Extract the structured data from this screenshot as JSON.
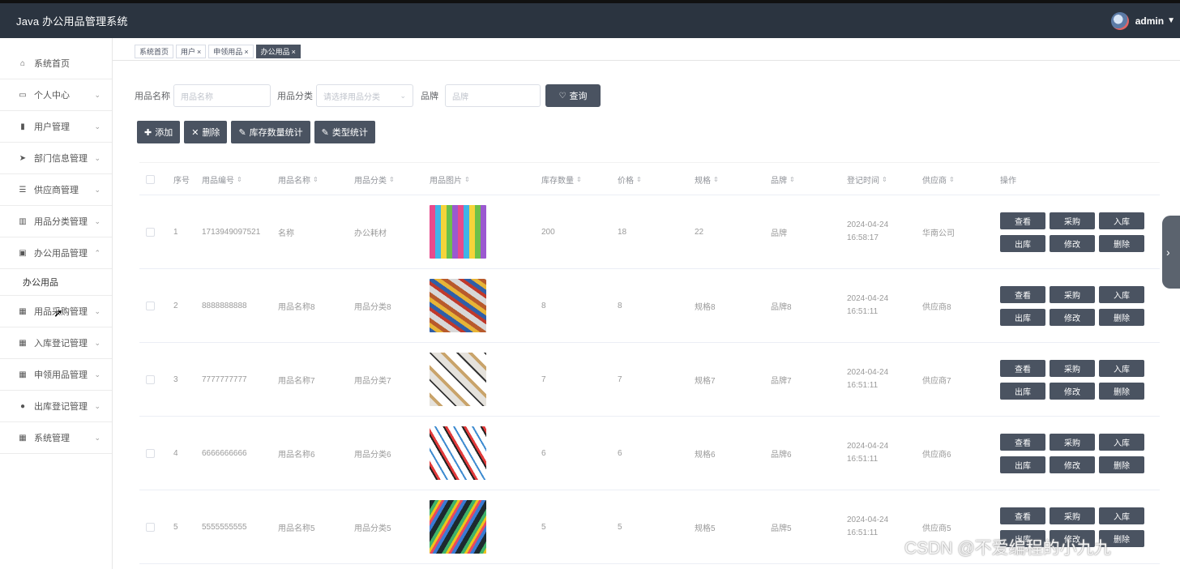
{
  "app": {
    "title": "Java 办公用品管理系统",
    "user": "admin"
  },
  "sidebar": {
    "items": [
      {
        "label": "系统首页",
        "icon": "home-icon",
        "glyph": "⌂",
        "arrow": false
      },
      {
        "label": "个人中心",
        "icon": "person-icon",
        "glyph": "▭",
        "arrow": true
      },
      {
        "label": "用户管理",
        "icon": "user-icon",
        "glyph": "▮",
        "arrow": true
      },
      {
        "label": "部门信息管理",
        "icon": "send-icon",
        "glyph": "➤",
        "arrow": true
      },
      {
        "label": "供应商管理",
        "icon": "sliders-icon",
        "glyph": "☰",
        "arrow": true
      },
      {
        "label": "用品分类管理",
        "icon": "bar-chart-icon",
        "glyph": "▥",
        "arrow": true
      },
      {
        "label": "办公用品管理",
        "icon": "clipboard-icon",
        "glyph": "▣",
        "arrow": true,
        "expanded": true
      },
      {
        "label": "用品采购管理",
        "icon": "grid-icon",
        "glyph": "▦",
        "arrow": true
      },
      {
        "label": "入库登记管理",
        "icon": "grid-icon",
        "glyph": "▦",
        "arrow": true
      },
      {
        "label": "申领用品管理",
        "icon": "grid-icon",
        "glyph": "▦",
        "arrow": true
      },
      {
        "label": "出库登记管理",
        "icon": "shield-icon",
        "glyph": "●",
        "arrow": true
      },
      {
        "label": "系统管理",
        "icon": "grid-icon",
        "glyph": "▦",
        "arrow": true
      }
    ],
    "subitem": "办公用品"
  },
  "tabs": [
    {
      "label": "系统首页",
      "closable": false
    },
    {
      "label": "用户",
      "closable": true
    },
    {
      "label": "申领用品",
      "closable": true
    },
    {
      "label": "办公用品",
      "closable": true,
      "active": true
    }
  ],
  "search": {
    "name_label": "用品名称",
    "name_placeholder": "用品名称",
    "category_label": "用品分类",
    "category_placeholder": "请选择用品分类",
    "brand_label": "品牌",
    "brand_placeholder": "品牌",
    "query_label": "查询"
  },
  "actions": [
    {
      "label": "添加",
      "icon": "plus-icon",
      "glyph": "✚"
    },
    {
      "label": "删除",
      "icon": "close-icon",
      "glyph": "✕"
    },
    {
      "label": "库存数量统计",
      "icon": "edit-icon",
      "glyph": "✎"
    },
    {
      "label": "类型统计",
      "icon": "edit-icon",
      "glyph": "✎"
    }
  ],
  "table": {
    "headers": [
      "序号",
      "用品编号",
      "用品名称",
      "用品分类",
      "用品图片",
      "库存数量",
      "价格",
      "规格",
      "品牌",
      "登记时间",
      "供应商",
      "操作"
    ],
    "rows": [
      {
        "idx": "1",
        "code": "1713949097521",
        "name": "名称",
        "category": "办公耗材",
        "stock": "200",
        "price": "18",
        "spec": "22",
        "brand": "品牌",
        "time": "2024-04-24 16:58:17",
        "supplier": "华南公司"
      },
      {
        "idx": "2",
        "code": "8888888888",
        "name": "用品名称8",
        "category": "用品分类8",
        "stock": "8",
        "price": "8",
        "spec": "规格8",
        "brand": "品牌8",
        "time": "2024-04-24 16:51:11",
        "supplier": "供应商8"
      },
      {
        "idx": "3",
        "code": "7777777777",
        "name": "用品名称7",
        "category": "用品分类7",
        "stock": "7",
        "price": "7",
        "spec": "规格7",
        "brand": "品牌7",
        "time": "2024-04-24 16:51:11",
        "supplier": "供应商7"
      },
      {
        "idx": "4",
        "code": "6666666666",
        "name": "用品名称6",
        "category": "用品分类6",
        "stock": "6",
        "price": "6",
        "spec": "规格6",
        "brand": "品牌6",
        "time": "2024-04-24 16:51:11",
        "supplier": "供应商6"
      },
      {
        "idx": "5",
        "code": "5555555555",
        "name": "用品名称5",
        "category": "用品分类5",
        "stock": "5",
        "price": "5",
        "spec": "规格5",
        "brand": "品牌5",
        "time": "2024-04-24 16:51:11",
        "supplier": "供应商5"
      }
    ],
    "ops": [
      "查看",
      "采购",
      "入库",
      "出库",
      "修改",
      "删除"
    ]
  },
  "watermark": "CSDN @不爱编程的小九九"
}
